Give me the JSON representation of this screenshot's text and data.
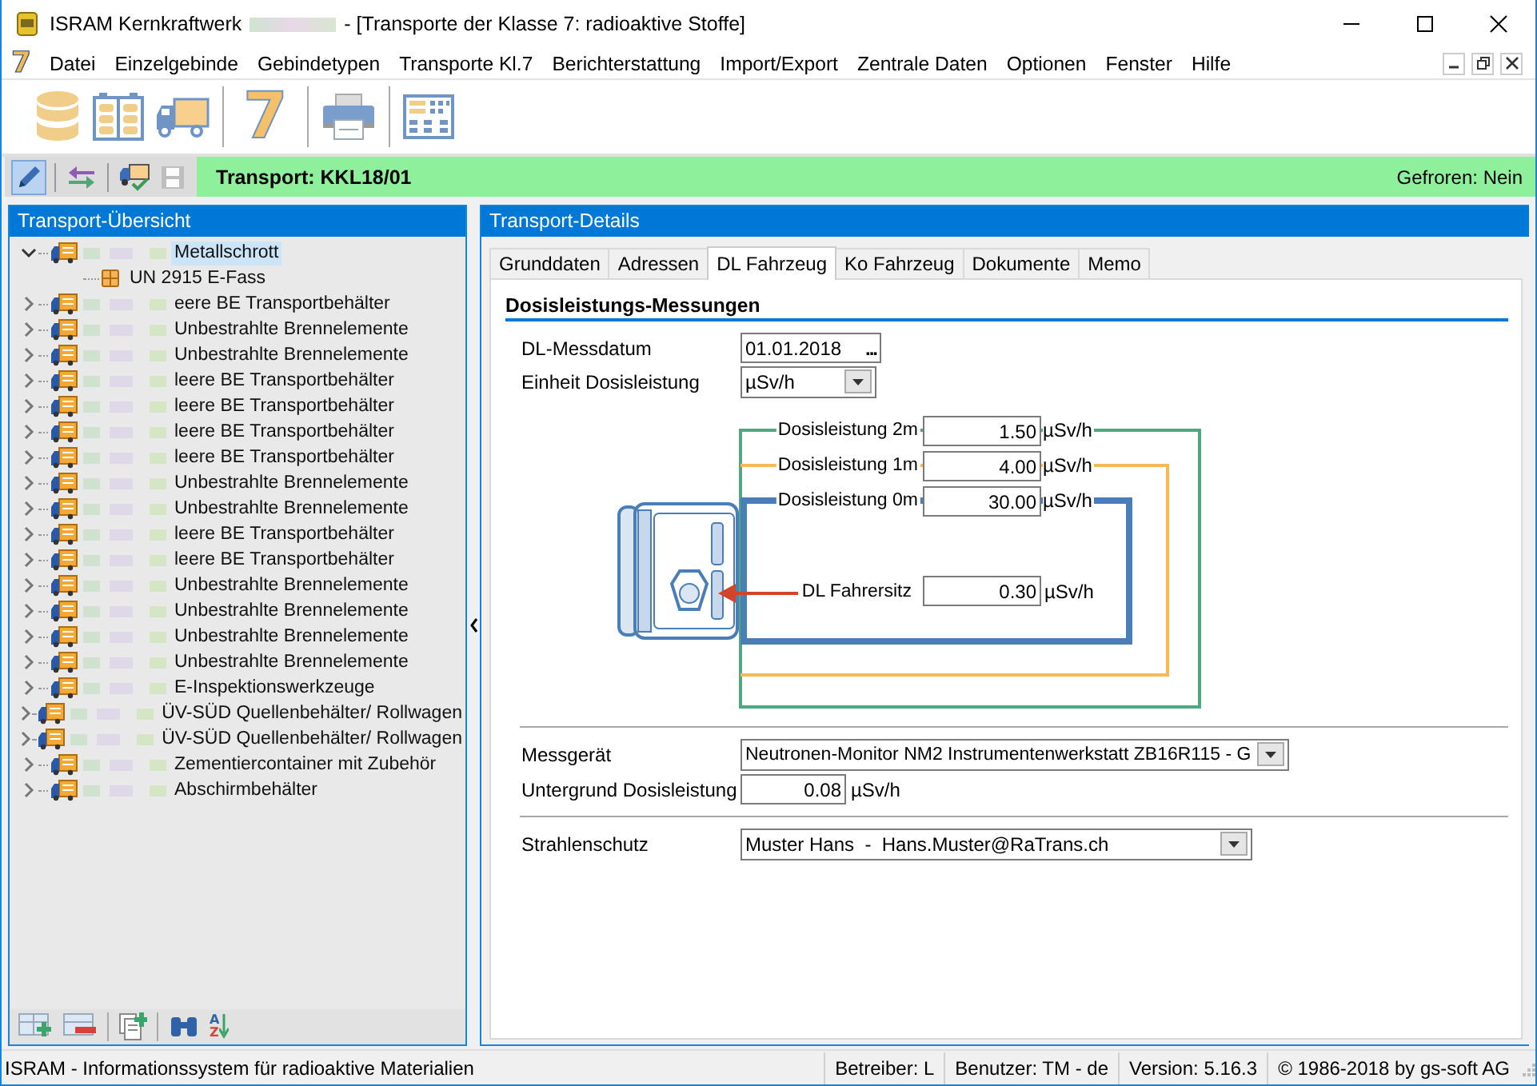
{
  "window": {
    "app_title": "ISRAM Kernkraftwerk",
    "document_title": "- [Transporte der Klasse 7: radioaktive Stoffe]"
  },
  "menu": {
    "logo": "7",
    "items": [
      "Datei",
      "Einzelgebinde",
      "Gebindetypen",
      "Transporte Kl.7",
      "Berichterstattung",
      "Import/Export",
      "Zentrale Daten",
      "Optionen",
      "Fenster",
      "Hilfe"
    ]
  },
  "toolbar": {
    "groups": [
      [
        {
          "kind": "database"
        },
        {
          "kind": "rack"
        },
        {
          "kind": "truck"
        }
      ],
      [
        {
          "kind": "class7",
          "label": "7"
        }
      ],
      [
        {
          "kind": "printer"
        }
      ],
      [
        {
          "kind": "report"
        }
      ]
    ]
  },
  "transport_bar": {
    "tools": [
      {
        "kind": "edit",
        "pressed": true,
        "disabled": false
      },
      {
        "kind": "swap",
        "pressed": false,
        "disabled": false
      },
      {
        "kind": "truck_check",
        "pressed": false,
        "disabled": false
      },
      {
        "kind": "save",
        "pressed": false,
        "disabled": true
      }
    ],
    "title": "Transport: KKL18/01",
    "frozen": "Gefroren: Nein"
  },
  "sidebar": {
    "title": "Transport-Übersicht",
    "tree": [
      {
        "label": "Metallschrott",
        "expanded": true,
        "selected": true,
        "children": [
          {
            "label": "UN 2915 E-Fass",
            "selected": false
          }
        ]
      },
      {
        "label": "eere BE Transportbehälter",
        "expanded": false,
        "selected": false
      },
      {
        "label": "Unbestrahlte Brennelemente",
        "expanded": false,
        "selected": false
      },
      {
        "label": "Unbestrahlte Brennelemente",
        "expanded": false,
        "selected": false
      },
      {
        "label": "leere BE Transportbehälter",
        "expanded": false,
        "selected": false
      },
      {
        "label": "leere BE Transportbehälter",
        "expanded": false,
        "selected": false
      },
      {
        "label": "leere BE Transportbehälter",
        "expanded": false,
        "selected": false
      },
      {
        "label": "leere BE Transportbehälter",
        "expanded": false,
        "selected": false
      },
      {
        "label": "Unbestrahlte Brennelemente",
        "expanded": false,
        "selected": false
      },
      {
        "label": "Unbestrahlte Brennelemente",
        "expanded": false,
        "selected": false
      },
      {
        "label": "leere BE Transportbehälter",
        "expanded": false,
        "selected": false
      },
      {
        "label": "leere BE Transportbehälter",
        "expanded": false,
        "selected": false
      },
      {
        "label": "Unbestrahlte Brennelemente",
        "expanded": false,
        "selected": false
      },
      {
        "label": "Unbestrahlte Brennelemente",
        "expanded": false,
        "selected": false
      },
      {
        "label": "Unbestrahlte Brennelemente",
        "expanded": false,
        "selected": false
      },
      {
        "label": "Unbestrahlte Brennelemente",
        "expanded": false,
        "selected": false
      },
      {
        "label": "E-Inspektionswerkzeuge",
        "expanded": false,
        "selected": false
      },
      {
        "label": "ÜV-SÜD Quellenbehälter/ Rollwagen",
        "expanded": false,
        "selected": false
      },
      {
        "label": "ÜV-SÜD Quellenbehälter/ Rollwagen",
        "expanded": false,
        "selected": false
      },
      {
        "label": "Zementiercontainer mit Zubehör",
        "expanded": false,
        "selected": false
      },
      {
        "label": "Abschirmbehälter",
        "expanded": false,
        "selected": false
      }
    ],
    "tools": [
      {
        "kind": "add"
      },
      {
        "kind": "remove"
      },
      {
        "kind": "copy"
      },
      {
        "kind": "find"
      },
      {
        "kind": "sort",
        "letters": [
          "A",
          "Z"
        ]
      }
    ]
  },
  "details": {
    "title": "Transport-Details",
    "tabs": [
      {
        "label": "Grunddaten",
        "selected": false
      },
      {
        "label": "Adressen",
        "selected": false
      },
      {
        "label": "DL Fahrzeug",
        "selected": true
      },
      {
        "label": "Ko Fahrzeug",
        "selected": false
      },
      {
        "label": "Dokumente",
        "selected": false
      },
      {
        "label": "Memo",
        "selected": false
      }
    ],
    "section": "Dosisleistungs-Messungen",
    "date": {
      "label": "DL-Messdatum",
      "value": "01.01.2018",
      "button": "..."
    },
    "unit_field": {
      "label": "Einheit Dosisleistung",
      "value": "µSv/h"
    },
    "measurements": [
      {
        "label": "Dosisleistung 2m",
        "value": "1.50",
        "unit": "µSv/h",
        "color": "#4eaa7e"
      },
      {
        "label": "Dosisleistung 1m",
        "value": "4.00",
        "unit": "µSv/h",
        "color": "#f6b955"
      },
      {
        "label": "Dosisleistung 0m",
        "value": "30.00",
        "unit": "µSv/h",
        "color": "#4a7eb9"
      }
    ],
    "driver_seat": {
      "label": "DL Fahrersitz",
      "value": "0.30",
      "unit": "µSv/h"
    },
    "instrument": {
      "label": "Messgerät",
      "value": "Neutronen-Monitor NM2 Instrumentenwerkstatt ZB16R115 - G"
    },
    "background": {
      "label": "Untergrund Dosisleistung",
      "value": "0.08",
      "unit": "µSv/h"
    },
    "radiation_protection": {
      "label": "Strahlenschutz",
      "value": "Muster Hans  -  Hans.Muster@RaTrans.ch"
    }
  },
  "status_bar": [
    "ISRAM - Informationssystem für radioaktive Materialien",
    "Betreiber: L",
    "Benutzer: TM - de",
    "Version: 5.16.3",
    "© 1986-2018 by gs-soft AG"
  ]
}
